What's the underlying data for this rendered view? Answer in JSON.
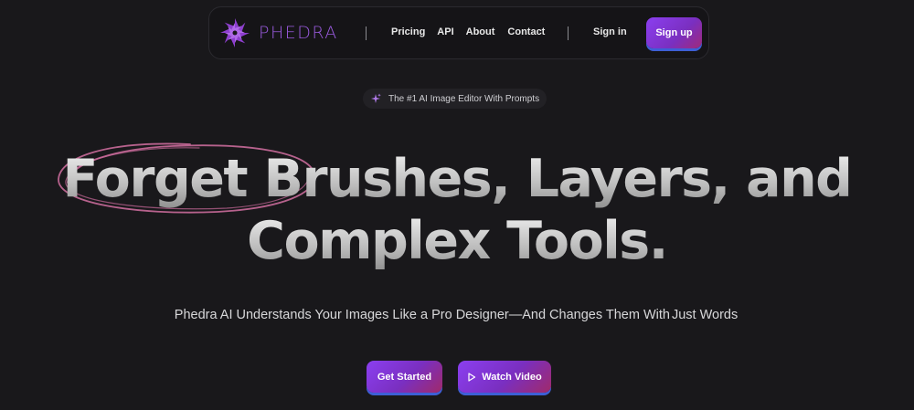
{
  "nav": {
    "brand": "PHEDRA",
    "links": [
      "Pricing",
      "API",
      "About",
      "Contact"
    ],
    "signin_label": "Sign in",
    "signup_label": "Sign up"
  },
  "badge": {
    "text": "The #1 AI Image Editor With Prompts",
    "icon": "sparkle-icon"
  },
  "hero": {
    "line1": "Forget Brushes, Layers, and",
    "line2": "Complex Tools."
  },
  "subtitle": {
    "before": "Phedra AI Understands Your Images Like a Pro Designer—And Changes Them With",
    "highlight": "Just Words"
  },
  "cta": {
    "primary_label": "Get Started",
    "secondary_label": "Watch Video",
    "secondary_icon": "play-icon"
  },
  "colors": {
    "background": "#19181b",
    "accent": "#8b3ff0",
    "brand": "#9b5be0",
    "scribble": "#c96a9a"
  }
}
